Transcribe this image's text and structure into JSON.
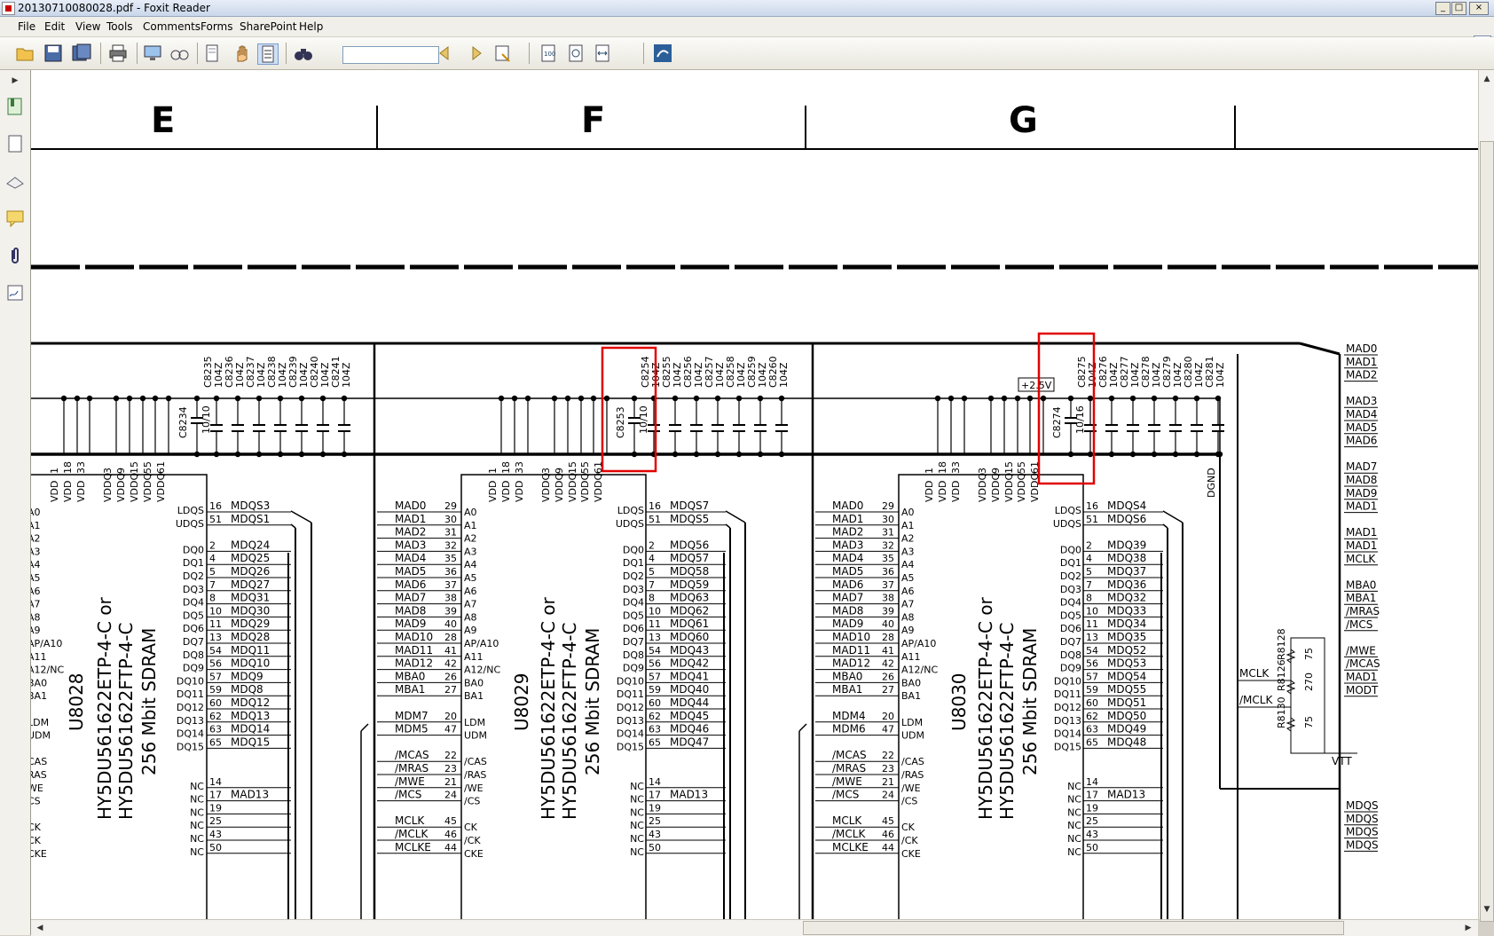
{
  "window": {
    "title": "20130710080028.pdf - Foxit Reader",
    "min": "_",
    "max": "□",
    "close": "×"
  },
  "menu": [
    "File",
    "Edit",
    "View",
    "Tools",
    "Comments",
    "Forms",
    "SharePoint",
    "Help"
  ],
  "toolbar": {
    "find_value": ""
  },
  "columns": [
    "E",
    "F",
    "G"
  ],
  "left_chip": {
    "ref": "U8028",
    "part1": "HY5DU561622ETP-4-C  or",
    "part2": "HY5DU561622FTP-4-C",
    "desc": "256 Mbit SDRAM",
    "caps_top": [
      "C8235",
      "C8236",
      "C8237",
      "C8238",
      "C8239",
      "C8240",
      "C8241"
    ],
    "caps_val": "104Z",
    "cap_small_ref": "C8234",
    "cap_small_val": "10/10",
    "pwr_pins": [
      "1",
      "18",
      "33",
      "3",
      "9",
      "15",
      "55",
      "61"
    ],
    "pwr_names": [
      "VDD",
      "VDD",
      "VDD",
      "VDDQ",
      "VDDQ",
      "VDDQ",
      "VDDQ",
      "VDDQ"
    ],
    "left_pins": [
      "A0",
      "A1",
      "A2",
      "A3",
      "A4",
      "A5",
      "A6",
      "A7",
      "A8",
      "A9",
      "AP/A10",
      "A11",
      "A12/NC",
      "BA0",
      "BA1",
      "",
      "LDM",
      "UDM",
      "",
      "CAS",
      "RAS",
      "WE",
      "CS",
      "",
      "CK",
      "CK",
      "CKE"
    ],
    "right_pin_names": [
      "LDQS",
      "UDQS",
      "",
      "DQ0",
      "DQ1",
      "DQ2",
      "DQ3",
      "DQ4",
      "DQ5",
      "DQ6",
      "DQ7",
      "DQ8",
      "DQ9",
      "DQ10",
      "DQ11",
      "DQ12",
      "DQ13",
      "DQ14",
      "DQ15",
      "",
      "",
      "NC",
      "NC",
      "NC",
      "NC",
      "NC",
      "NC"
    ],
    "right_pin_nums": [
      "16",
      "51",
      "",
      "2",
      "4",
      "5",
      "7",
      "8",
      "10",
      "11",
      "13",
      "54",
      "56",
      "57",
      "59",
      "60",
      "62",
      "63",
      "65",
      "",
      "",
      "14",
      "17",
      "19",
      "25",
      "43",
      "50"
    ],
    "right_nets": [
      "MDQS3",
      "MDQS1",
      "",
      "MDQ24",
      "MDQ25",
      "MDQ26",
      "MDQ27",
      "MDQ31",
      "MDQ30",
      "MDQ29",
      "MDQ28",
      "MDQ11",
      "MDQ10",
      "MDQ9",
      "MDQ8",
      "MDQ12",
      "MDQ13",
      "MDQ14",
      "MDQ15",
      "",
      "",
      "",
      "MAD13",
      "",
      "",
      "",
      ""
    ]
  },
  "mid_chip": {
    "ref": "U8029",
    "part1": "HY5DU561622ETP-4-C  or",
    "part2": "HY5DU561622FTP-4-C",
    "desc": "256 Mbit SDRAM",
    "caps_top": [
      "C8254",
      "C8255",
      "C8256",
      "C8257",
      "C8258",
      "C8259",
      "C8260"
    ],
    "caps_val": "104Z",
    "cap_small_ref": "C8253",
    "cap_small_val": "10/10",
    "left_nets": [
      "MAD0",
      "MAD1",
      "MAD2",
      "MAD3",
      "MAD4",
      "MAD5",
      "MAD6",
      "MAD7",
      "MAD8",
      "MAD9",
      "MAD10",
      "MAD11",
      "MAD12",
      "MBA0",
      "MBA1",
      "",
      "MDM7",
      "MDM5",
      "",
      "/MCAS",
      "/MRAS",
      "/MWE",
      "/MCS",
      "",
      "MCLK",
      "/MCLK",
      "MCLKE"
    ],
    "left_nums": [
      "29",
      "30",
      "31",
      "32",
      "35",
      "36",
      "37",
      "38",
      "39",
      "40",
      "28",
      "41",
      "42",
      "26",
      "27",
      "",
      "20",
      "47",
      "",
      "22",
      "23",
      "21",
      "24",
      "",
      "45",
      "46",
      "44"
    ],
    "left_pins": [
      "A0",
      "A1",
      "A2",
      "A3",
      "A4",
      "A5",
      "A6",
      "A7",
      "A8",
      "A9",
      "AP/A10",
      "A11",
      "A12/NC",
      "BA0",
      "BA1",
      "",
      "LDM",
      "UDM",
      "",
      "/CAS",
      "/RAS",
      "/WE",
      "/CS",
      "",
      "CK",
      "/CK",
      "CKE"
    ],
    "right_pin_names": [
      "LDQS",
      "UDQS",
      "",
      "DQ0",
      "DQ1",
      "DQ2",
      "DQ3",
      "DQ4",
      "DQ5",
      "DQ6",
      "DQ7",
      "DQ8",
      "DQ9",
      "DQ10",
      "DQ11",
      "DQ12",
      "DQ13",
      "DQ14",
      "DQ15",
      "",
      "",
      "NC",
      "NC",
      "NC",
      "NC",
      "NC",
      "NC"
    ],
    "right_pin_nums": [
      "16",
      "51",
      "",
      "2",
      "4",
      "5",
      "7",
      "8",
      "10",
      "11",
      "13",
      "54",
      "56",
      "57",
      "59",
      "60",
      "62",
      "63",
      "65",
      "",
      "",
      "14",
      "17",
      "19",
      "25",
      "43",
      "50"
    ],
    "right_nets": [
      "MDQS7",
      "MDQS5",
      "",
      "MDQ56",
      "MDQ57",
      "MDQ58",
      "MDQ59",
      "MDQ63",
      "MDQ62",
      "MDQ61",
      "MDQ60",
      "MDQ43",
      "MDQ42",
      "MDQ41",
      "MDQ40",
      "MDQ44",
      "MDQ45",
      "MDQ46",
      "MDQ47",
      "",
      "",
      "",
      "MAD13",
      "",
      "",
      "",
      ""
    ]
  },
  "right_chip": {
    "ref": "U8030",
    "part1": "HY5DU561622ETP-4-C  or",
    "part2": "HY5DU561622FTP-4-C",
    "desc": "256 Mbit SDRAM",
    "caps_top": [
      "C8275",
      "C8276",
      "C8277",
      "C8278",
      "C8279",
      "C8280",
      "C8281"
    ],
    "caps_val": "104Z",
    "cap_small_ref": "C8274",
    "cap_small_val": "10/16",
    "rail": "+2.5V",
    "dgnd": "DGND",
    "left_nets": [
      "MAD0",
      "MAD1",
      "MAD2",
      "MAD3",
      "MAD4",
      "MAD5",
      "MAD6",
      "MAD7",
      "MAD8",
      "MAD9",
      "MAD10",
      "MAD11",
      "MAD12",
      "MBA0",
      "MBA1",
      "",
      "MDM4",
      "MDM6",
      "",
      "/MCAS",
      "/MRAS",
      "/MWE",
      "/MCS",
      "",
      "MCLK",
      "/MCLK",
      "MCLKE"
    ],
    "right_nets": [
      "MDQS4",
      "MDQS6",
      "",
      "MDQ39",
      "MDQ38",
      "MDQ37",
      "MDQ36",
      "MDQ32",
      "MDQ33",
      "MDQ34",
      "MDQ35",
      "MDQ52",
      "MDQ53",
      "MDQ54",
      "MDQ55",
      "MDQ51",
      "MDQ50",
      "MDQ49",
      "MDQ48",
      "",
      "",
      "",
      "MAD13",
      "",
      "",
      "",
      ""
    ]
  },
  "far_right": {
    "nets": [
      "MAD0",
      "MAD1",
      "MAD2",
      "",
      "MAD3",
      "MAD4",
      "MAD5",
      "MAD6",
      "",
      "MAD7",
      "MAD8",
      "MAD9",
      "MAD1",
      "",
      "MAD1",
      "MAD1",
      "MCLK",
      "",
      "MBA0",
      "MBA1",
      "/MRAS",
      "/MCS",
      "",
      "/MWE",
      "/MCAS",
      "MAD1",
      "MODT"
    ],
    "bottom_nets": [
      "MDQS",
      "MDQS",
      "MDQS",
      "MDQS"
    ],
    "resistors": [
      {
        "ref": "R8128",
        "val": "75"
      },
      {
        "ref": "R8126",
        "val": "270"
      },
      {
        "ref": "R8130",
        "val": "75"
      }
    ],
    "mclk": "MCLK",
    "nmclk": "/MCLK",
    "vtt": "VTT"
  }
}
